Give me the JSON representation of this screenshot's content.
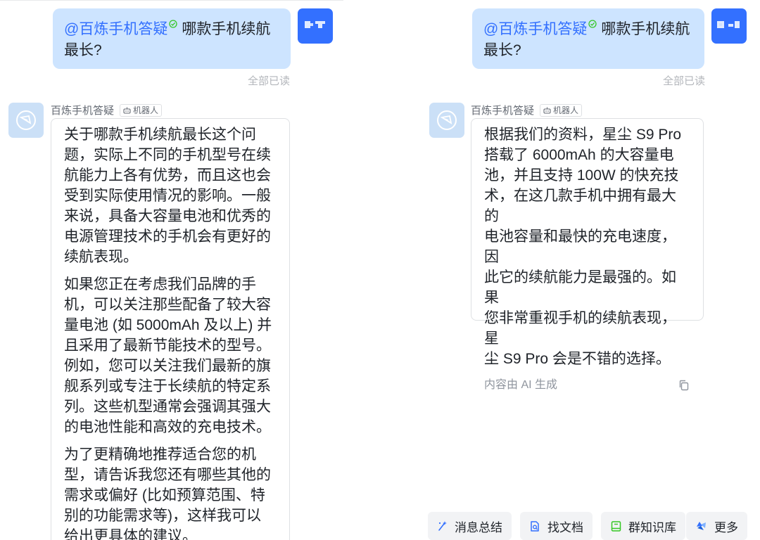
{
  "question": {
    "mention": "@百炼手机答疑",
    "text_line1": "哪款手机续航",
    "text_line2": "最长?"
  },
  "read_status": "全部已读",
  "bot": {
    "name": "百炼手机答疑",
    "tag": "机器人"
  },
  "left_answer": {
    "paragraphs": [
      [
        "关于哪款手机续航最长这个问",
        "题，实际上不同的手机型号在续",
        "航能力上各有优势，而且这也会",
        "受到实际使用情况的影响。一般",
        "来说，具备大容量电池和优秀的",
        "电源管理技术的手机会有更好的",
        "续航表现。"
      ],
      [
        "如果您正在考虑我们品牌的手",
        "机，可以关注那些配备了较大容",
        "量电池 (如 5000mAh 及以上) 并",
        "且采用了最新节能技术的型号。",
        "例如，您可以关注我们最新的旗",
        "舰系列或专注于长续航的特定系",
        "列。这些机型通常会强调其强大",
        "的电池性能和高效的充电技术。"
      ],
      [
        "为了更精确地推荐适合您的机",
        "型，请告诉我您还有哪些其他的",
        "需求或偏好 (比如预算范围、特",
        "别的功能需求等)，这样我可以",
        "给出更具体的建议。"
      ]
    ]
  },
  "right_answer": {
    "lines": [
      "根据我们的资料，星尘 S9 Pro",
      "搭载了 6000mAh 的大容量电",
      "池，并且支持 100W 的快充技",
      "术，在这几款手机中拥有最大的",
      "电池容量和最快的充电速度，因",
      "此它的续航能力是最强的。如果",
      "您非常重视手机的续航表现，星",
      "尘 S9 Pro 会是不错的选择。"
    ],
    "footer": "内容由 AI 生成"
  },
  "quick_actions": [
    {
      "label": "消息总结",
      "icon": "sparkle-icon"
    },
    {
      "label": "找文档",
      "icon": "doc-search-icon"
    },
    {
      "label": "群知识库",
      "icon": "book-icon"
    },
    {
      "label": "更多",
      "icon": "more-apps-icon"
    }
  ],
  "colors": {
    "accent": "#3370ff",
    "user_bubble": "#cde4ff",
    "bot_avatar": "#cbe0f7",
    "chip_bg": "#f2f3f5",
    "book_icon": "#34c724"
  }
}
